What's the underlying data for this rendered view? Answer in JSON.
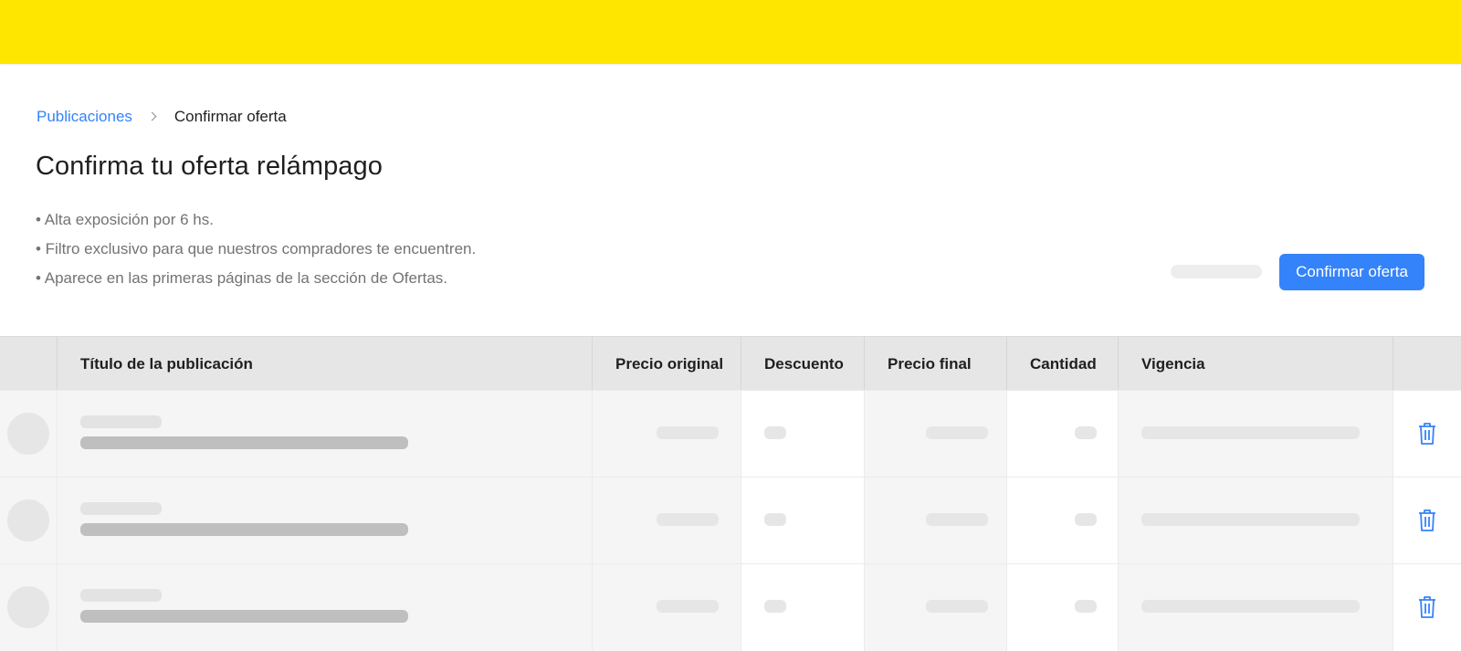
{
  "colors": {
    "header_bg": "#ffe600",
    "accent": "#3483fa",
    "table_header_bg": "#e6e6e6",
    "row_bg": "#f5f5f5"
  },
  "breadcrumb": {
    "parent": "Publicaciones",
    "current": "Confirmar oferta",
    "separator_icon": "chevron-right-icon"
  },
  "page_title": "Confirma tu oferta relámpago",
  "benefits": [
    "• Alta exposición por 6 hs.",
    "• Filtro exclusivo para que nuestros compradores te encuentren.",
    "• Aparece en las primeras páginas de la sección de Ofertas."
  ],
  "actions": {
    "confirm_label": "Confirmar oferta"
  },
  "table": {
    "columns": [
      "",
      "Título de la publicación",
      "Precio original",
      "Descuento",
      "Precio final",
      "Cantidad",
      "Vigencia",
      ""
    ],
    "rows_loading": 3,
    "row_action_icon": "trash-icon"
  }
}
